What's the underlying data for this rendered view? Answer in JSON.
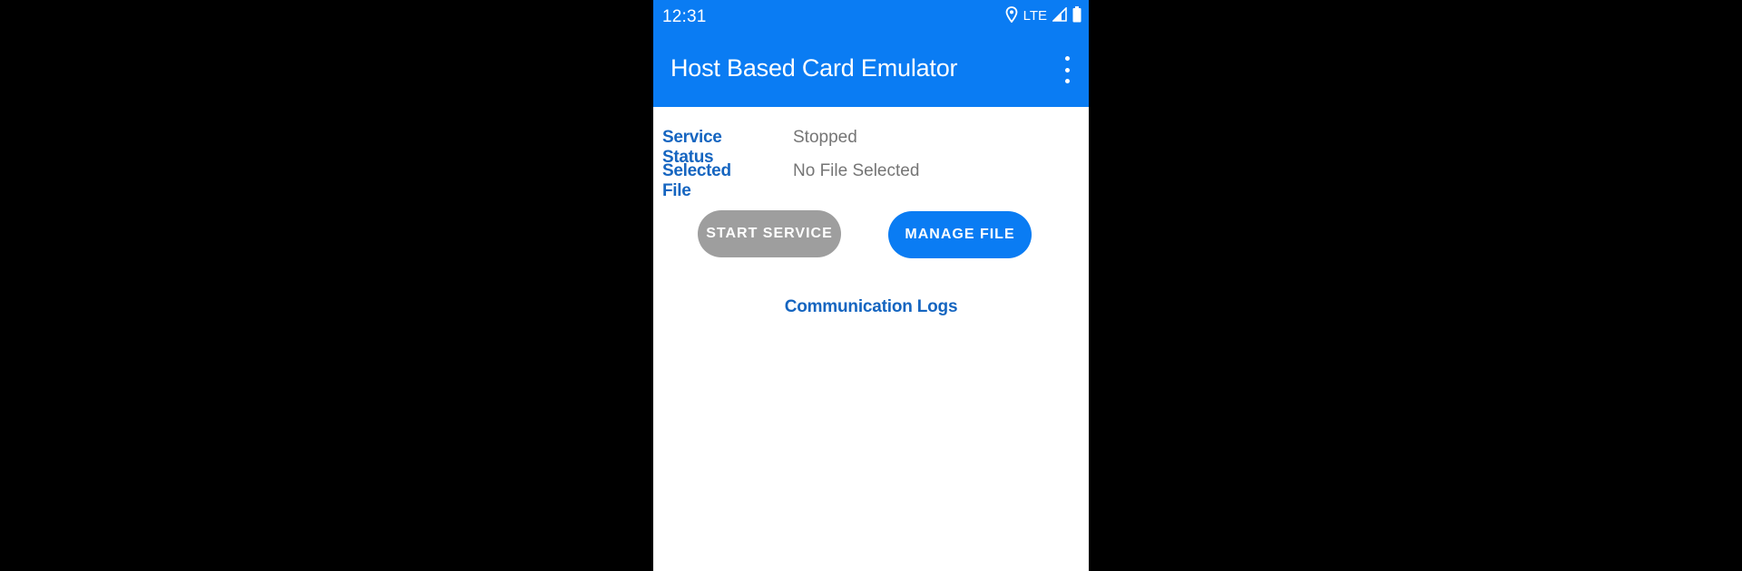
{
  "status_bar": {
    "time": "12:31",
    "network": "LTE",
    "icons": [
      "location-icon",
      "signal-icon",
      "battery-icon"
    ]
  },
  "app_bar": {
    "title": "Host Based Card Emulator",
    "menu_icon": "more-vert-icon"
  },
  "service": {
    "status_label": "Service Status",
    "status_value": "Stopped",
    "file_label": "Selected File",
    "file_value": "No File Selected"
  },
  "actions": {
    "start_label": "START SERVICE",
    "manage_label": "MANAGE FILE"
  },
  "logs": {
    "label": "Communication Logs"
  },
  "colors": {
    "primary": "#0a7cf3",
    "label_blue": "#1565c0",
    "disabled_gray": "#9e9e9e",
    "value_gray": "#757575",
    "background": "#000000"
  }
}
